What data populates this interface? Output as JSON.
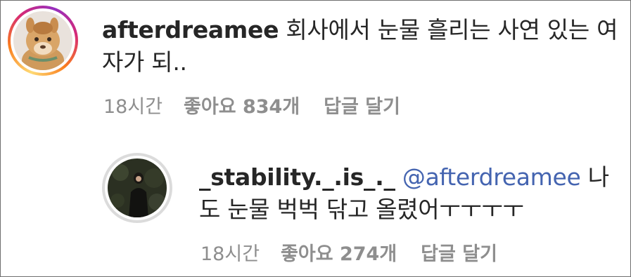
{
  "comment": {
    "username": "afterdreamee",
    "text": "회사에서 눈물 흘리는 사연 있는 여자가 되..",
    "time": "18시간",
    "likes": "좋아요 834개",
    "reply_label": "답글 달기"
  },
  "reply": {
    "username": "_stability._.is_._",
    "mention": "@afterdreamee",
    "text": "나도 눈물 벅벅 닦고 올렸어ㅜㅜㅜㅜ",
    "time": "18시간",
    "likes": "좋아요 274개",
    "reply_label": "답글 달기"
  },
  "colors": {
    "text": "#262626",
    "secondary": "#8e8e8e",
    "mention": "#4464b0",
    "story_ring": [
      "#feda75",
      "#fa7e1e",
      "#d62976",
      "#962fbf"
    ]
  }
}
